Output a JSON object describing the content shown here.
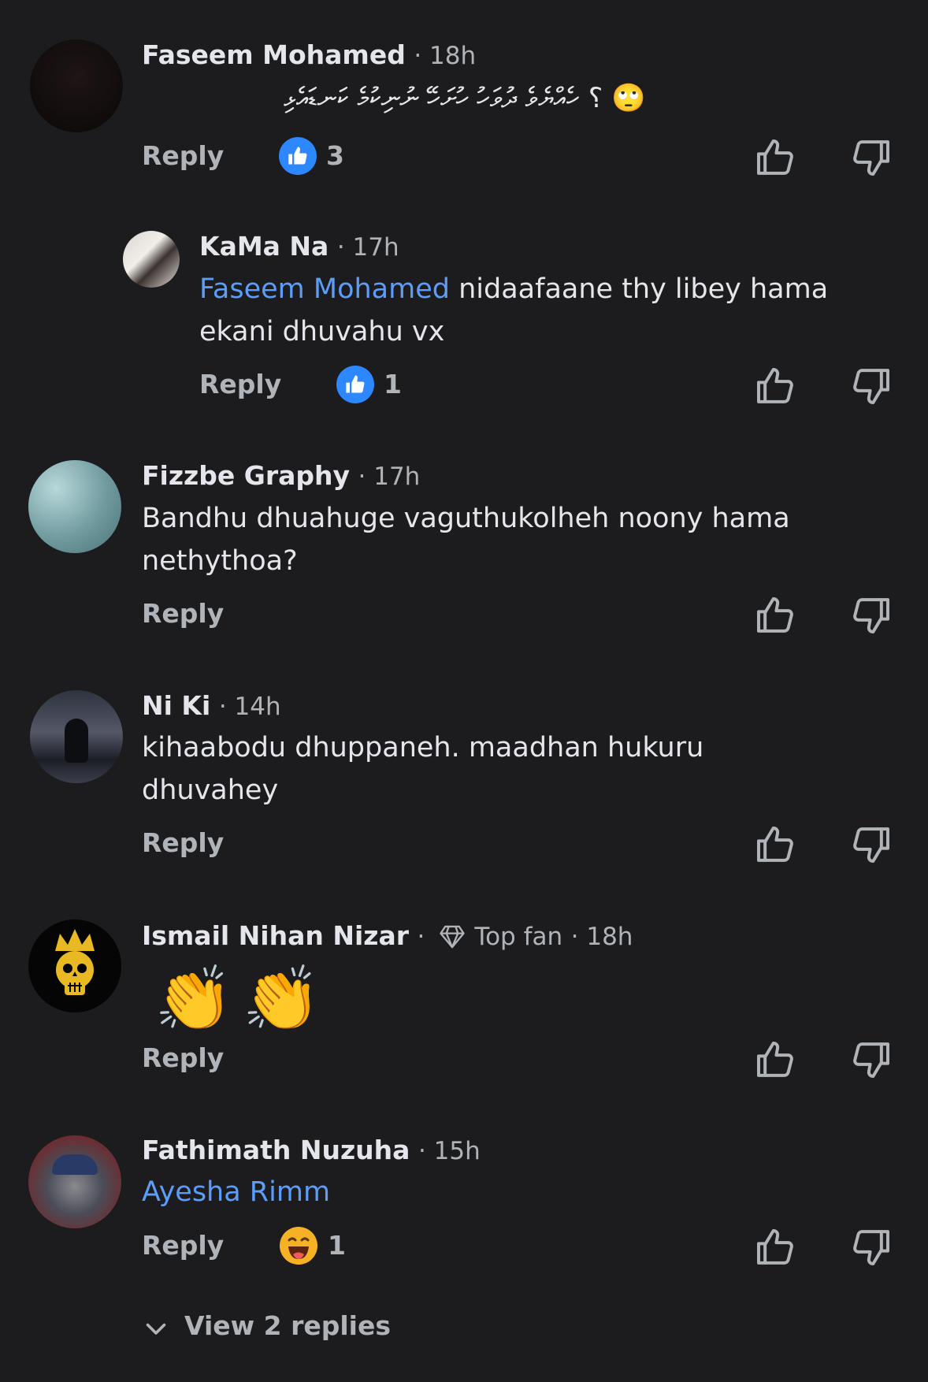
{
  "comments": [
    {
      "name": "Faseem Mohamed",
      "time": "· 18h",
      "text": "🙄 ؟ ހެއްޔެވެ ދުވަހު ހުށަހޭ ނުނިކުމެ ކަނޑައެޅި",
      "reply_label": "Reply",
      "reaction_count": "3"
    },
    {
      "name": "KaMa Na",
      "time": "· 17h",
      "mention": "Faseem Mohamed",
      "text": " nidaafaane thy libey hama ekani dhuvahu vx",
      "reply_label": "Reply",
      "reaction_count": "1"
    },
    {
      "name": "Fizzbe Graphy",
      "time": "· 17h",
      "text": "Bandhu dhuahuge vaguthukolheh noony hama nethythoa?",
      "reply_label": "Reply"
    },
    {
      "name": "Ni Ki",
      "time": "· 14h",
      "text": "kihaabodu dhuppaneh. maadhan hukuru dhuvahey",
      "reply_label": "Reply"
    },
    {
      "name": "Ismail Nihan Nizar",
      "sep": "·",
      "badge": "Top fan",
      "time": "· 18h",
      "emojis": [
        "👏",
        "👏"
      ],
      "reply_label": "Reply"
    },
    {
      "name": "Fathimath Nuzuha",
      "time": "· 15h",
      "mention": "Ayesha Rimm",
      "reply_label": "Reply",
      "reaction_count": "1"
    }
  ],
  "view_replies": "View 2 replies",
  "colors": {
    "background": "#1c1c1e",
    "mention": "#5b9df9",
    "like_badge": "#2d88ff",
    "haha_badge": "#f7b125"
  }
}
